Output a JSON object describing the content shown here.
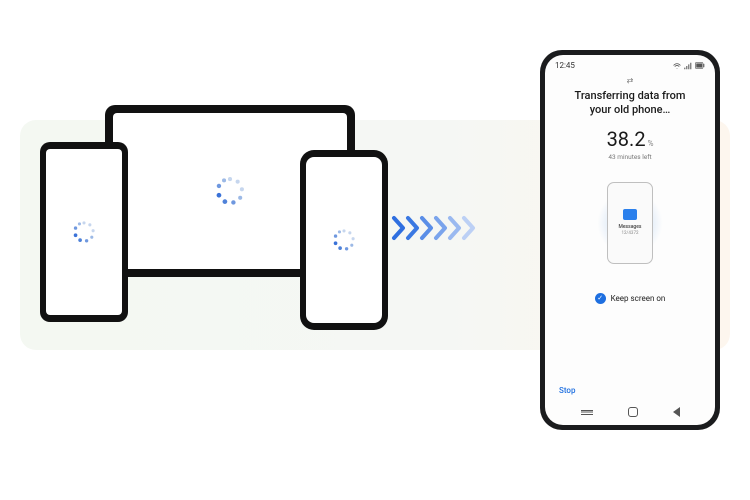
{
  "statusbar": {
    "time": "12:45"
  },
  "transfer": {
    "title_line1": "Transferring data from",
    "title_line2": "your old phone…",
    "percent_value": "38.2",
    "percent_unit": "%",
    "time_left": "43 minutes left",
    "category_label": "Messages",
    "category_progress": "12/4372",
    "keep_screen_label": "Keep screen on"
  },
  "actions": {
    "stop": "Stop"
  },
  "colors": {
    "accent": "#1e6fe0",
    "spinner_dark": "#3a72d8",
    "spinner_light": "#c6d6ee"
  }
}
